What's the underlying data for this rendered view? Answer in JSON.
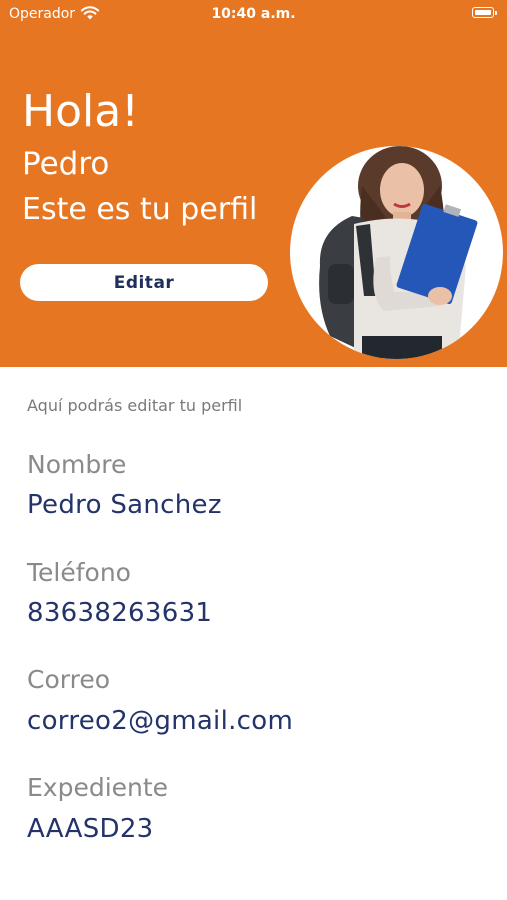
{
  "status_bar": {
    "carrier": "Operador",
    "time": "10:40 a.m.",
    "wifi_icon": "wifi-icon",
    "battery_icon": "battery-icon"
  },
  "header": {
    "greeting": "Hola!",
    "name": "Pedro",
    "subtitle": "Este es tu perfil",
    "edit_label": "Editar",
    "background_color": "#E67622",
    "avatar_icon": "student-photo"
  },
  "profile": {
    "hint": "Aquí podrás editar tu perfil",
    "fields": [
      {
        "label": "Nombre",
        "value": "Pedro Sanchez"
      },
      {
        "label": "Teléfono",
        "value": "83638263631"
      },
      {
        "label": "Correo",
        "value": "correo2@gmail.com"
      },
      {
        "label": "Expediente",
        "value": "AAASD23"
      }
    ]
  },
  "colors": {
    "accent": "#E67622",
    "value_text": "#24346B",
    "label_text": "#8A8A8A"
  }
}
